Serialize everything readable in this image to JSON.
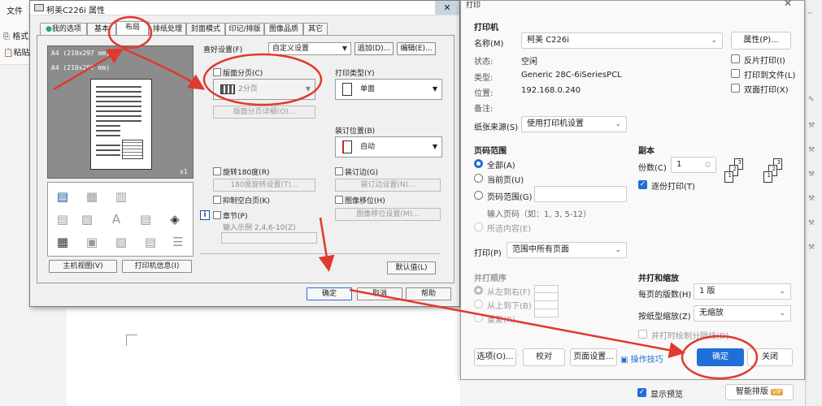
{
  "word": {
    "menu_file": "文件",
    "ribbon_format": "格式",
    "ribbon_paste": "粘贴"
  },
  "props": {
    "title": "柯美C226i 属性",
    "close": "✕",
    "tabs": [
      "我的选项",
      "基本",
      "布局",
      "排纸处理",
      "封面模式",
      "印记/排版",
      "图像品质",
      "其它"
    ],
    "active_tab": "布局",
    "preview": {
      "size1": "A4  (210x297 mm)",
      "size2": "A4  (210x297 mm)",
      "scale": "x1"
    },
    "btn_host_view": "主机视图(V)",
    "btn_printer_info": "打印机信息(I)",
    "fav_label": "喜好设置(F)",
    "fav_value": "自定义设置",
    "btn_add": "追加(D)...",
    "btn_edit": "编辑(E)...",
    "layout_cb": "版面分页(C)",
    "layout_value": "2分页",
    "btn_layout_detail": "版面分页详细(O)...",
    "rotate_cb": "旋转180度(R)",
    "btn_rotate": "180度旋转设置(T)...",
    "suppress_blank_cb": "抑制空白页(K)",
    "chapter_cb": "章节(P)",
    "chapter_hint": "输入示例 2,4,6-10(Z)",
    "print_type_label": "打印类型(Y)",
    "print_type_value": "单面",
    "binding_label": "装订位置(B)",
    "binding_value": "自动",
    "binding_margin_cb": "装订边(G)",
    "btn_binding": "装订边设置(N)...",
    "image_shift_cb": "图像移位(H)",
    "btn_image_shift": "图像移位设置(M)...",
    "btn_default": "默认值(L)",
    "btn_ok": "确定",
    "btn_cancel": "取消",
    "btn_help": "帮助"
  },
  "print": {
    "title": "打印",
    "printer_heading": "打印机",
    "name_label": "名称(M)",
    "name_value": "柯美 C226i",
    "btn_properties": "属性(P)...",
    "status_label": "状态:",
    "status_value": "空闲",
    "type_label": "类型:",
    "type_value": "Generic 28C-6iSeriesPCL",
    "location_label": "位置:",
    "location_value": "192.168.0.240",
    "note_label": "备注:",
    "reverse_print": "反片打印(I)",
    "print_to_file": "打印到文件(L)",
    "duplex_print": "双面打印(X)",
    "paper_source_label": "纸张来源(S)",
    "paper_source_value": "使用打印机设置",
    "page_range_heading": "页码范围",
    "range_all": "全部(A)",
    "range_current": "当前页(U)",
    "range_pages": "页码范围(G)",
    "range_hint": "输入页码（如：1, 3, 5-12）",
    "range_selection": "所选内容(E)",
    "copies_heading": "副本",
    "copies_label": "份数(C)",
    "copies_value": "1",
    "collate": "逐份打印(T)",
    "print_label": "打印(P)",
    "print_value": "范围中所有页面",
    "order_heading": "并打顺序",
    "order_lr": "从左到右(F)",
    "order_tb": "从上到下(B)",
    "order_repeat": "重复(R)",
    "merge_heading": "并打和缩放",
    "pages_per_sheet_label": "每页的版数(H)",
    "pages_per_sheet_value": "1 版",
    "scale_label": "按纸型缩放(Z)",
    "scale_value": "无缩放",
    "draw_sep": "并打时绘制分隔线(D)",
    "btn_options": "选项(O)...",
    "btn_proof": "校对",
    "btn_page_setup": "页面设置...",
    "tips": "操作技巧",
    "btn_ok": "确定",
    "btn_close": "关闭",
    "show_preview": "显示预览",
    "smart_layout": "智能排版",
    "vip": "VIP"
  },
  "colors": {
    "accent": "#1f6fd6",
    "annotation": "#e0392f"
  },
  "icons": {
    "printer": "printer-icon",
    "info": "info-icon",
    "close": "close-icon",
    "chevron": "chevron-down-icon",
    "tips": "tips-icon"
  }
}
